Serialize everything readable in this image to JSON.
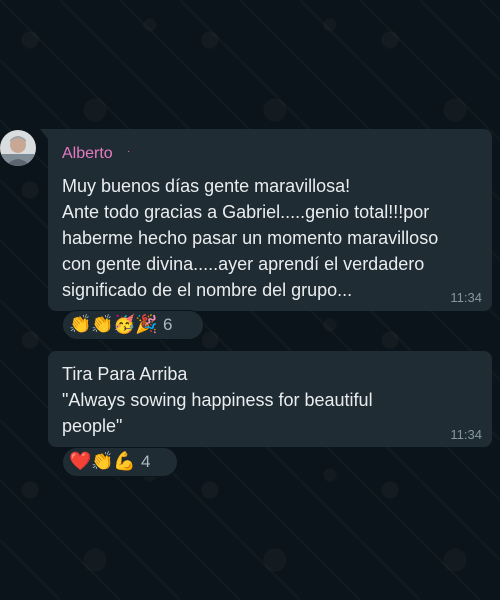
{
  "messages": [
    {
      "sender": "Alberto",
      "sender_color": "#e47ac2",
      "text": "Muy buenos días gente maravillosa!\nAnte todo gracias a Gabriel.....genio total!!!por\nhaberme hecho pasar un momento maravilloso\ncon gente divina.....ayer aprendí el verdadero\nsignificado de el nombre del grupo...",
      "time": "11:34",
      "reactions": [
        "👏",
        "👏",
        "🥳",
        "🎉"
      ],
      "reaction_count": "6"
    },
    {
      "text": "Tira Para Arriba\n\"Always sowing happiness for beautiful\npeople\"",
      "time": "11:34",
      "reactions": [
        "❤️",
        "👏",
        "💪"
      ],
      "reaction_count": "4"
    }
  ],
  "colors": {
    "background": "#0b141a",
    "bubble": "#202c33",
    "text": "#e9edef",
    "time": "#8696a0"
  }
}
